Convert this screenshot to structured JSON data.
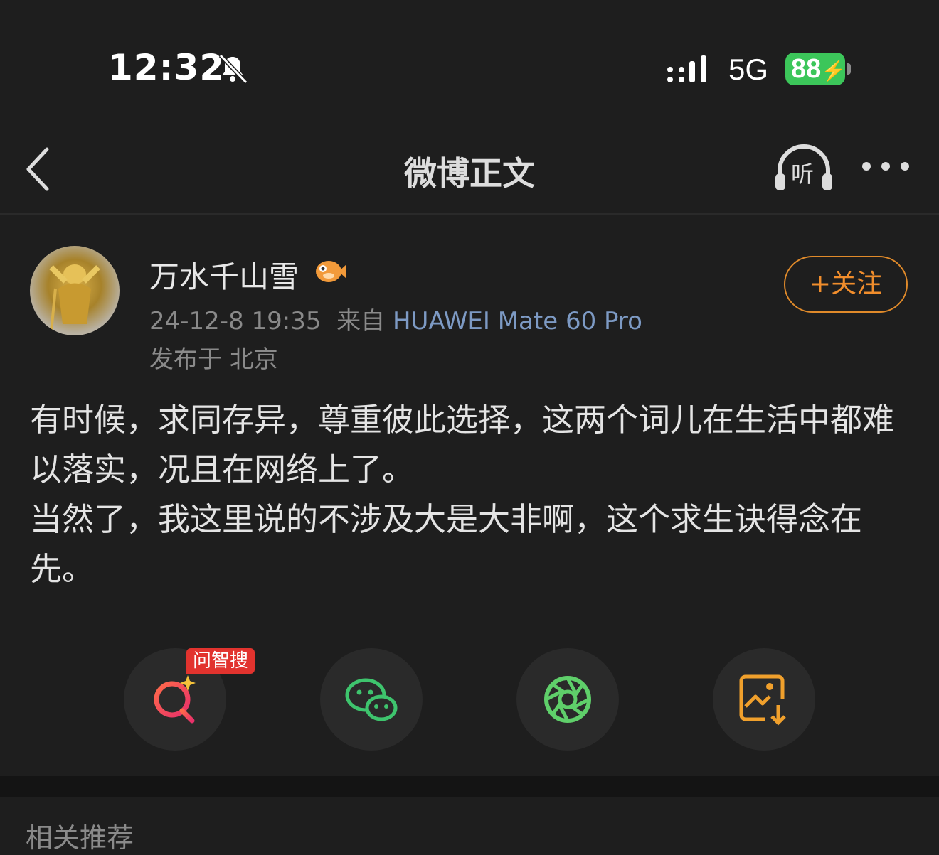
{
  "status_bar": {
    "time": "12:32",
    "network": "5G",
    "battery": "88"
  },
  "nav": {
    "title": "微博正文",
    "listen_label": "听"
  },
  "post": {
    "author": "万水千山雪",
    "date": "24-12-8 19:35",
    "source_prefix": "来自",
    "device": "HUAWEI Mate 60 Pro",
    "location": "发布于 北京",
    "follow_label": "+关注",
    "paragraphs": [
      "有时候，求同存异，尊重彼此选择，这两个词儿在生活中都难以落实，况且在网络上了。",
      "当然了，我这里说的不涉及大是大非啊，这个求生诀得念在先。"
    ]
  },
  "actions": {
    "ai_tag": "问智搜",
    "items": [
      "ai-search",
      "wechat",
      "moments",
      "save-image"
    ]
  },
  "related": {
    "title": "相关推荐"
  },
  "colors": {
    "accent": "#f08d2c",
    "battery": "#3cc65a",
    "device_link": "#7d9ac4",
    "tag": "#e2332e"
  }
}
